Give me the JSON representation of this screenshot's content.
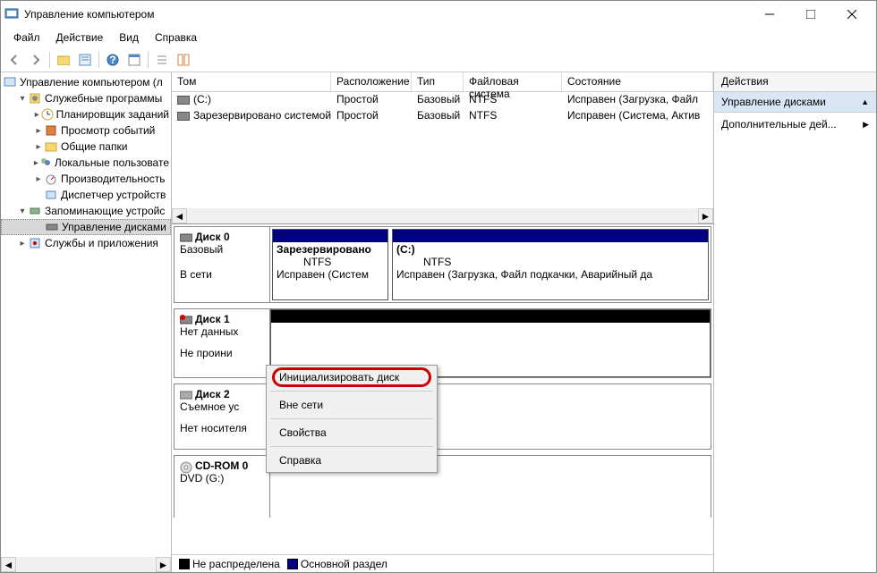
{
  "window": {
    "title": "Управление компьютером"
  },
  "menu": {
    "file": "Файл",
    "action": "Действие",
    "view": "Вид",
    "help": "Справка"
  },
  "tree": {
    "root": "Управление компьютером (л",
    "system_tools": "Служебные программы",
    "task_scheduler": "Планировщик заданий",
    "event_viewer": "Просмотр событий",
    "shared_folders": "Общие папки",
    "local_users": "Локальные пользовате",
    "performance": "Производительность",
    "device_manager": "Диспетчер устройств",
    "storage": "Запоминающие устройс",
    "disk_mgmt": "Управление дисками",
    "services": "Службы и приложения"
  },
  "grid": {
    "h_vol": "Том",
    "h_lay": "Расположение",
    "h_typ": "Тип",
    "h_fs": "Файловая система",
    "h_st": "Состояние",
    "rows": [
      {
        "vol": "(C:)",
        "lay": "Простой",
        "typ": "Базовый",
        "fs": "NTFS",
        "st": "Исправен (Загрузка, Файл"
      },
      {
        "vol": "Зарезервировано системой",
        "lay": "Простой",
        "typ": "Базовый",
        "fs": "NTFS",
        "st": "Исправен (Система, Актив"
      }
    ]
  },
  "disks": {
    "d0": {
      "label": "Диск 0",
      "type": "Базовый",
      "status": "В сети",
      "p1": {
        "name": "Зарезервировано",
        "fs": "NTFS",
        "st": "Исправен (Систем"
      },
      "p2": {
        "name": "(C:)",
        "fs": "NTFS",
        "st": "Исправен (Загрузка, Файл подкачки, Аварийный да"
      }
    },
    "d1": {
      "label": "Диск 1",
      "type": "Нет данных",
      "status": "Не проини"
    },
    "d2": {
      "label": "Диск 2",
      "type": "Съемное ус",
      "status": "Нет носителя"
    },
    "cd": {
      "label": "CD-ROM 0",
      "type": "DVD (G:)"
    }
  },
  "ctx": {
    "init": "Инициализировать диск",
    "offline": "Вне сети",
    "props": "Свойства",
    "help": "Справка"
  },
  "legend": {
    "unalloc": "Не распределена",
    "primary": "Основной раздел"
  },
  "actions": {
    "header": "Действия",
    "sel": "Управление дисками",
    "more": "Дополнительные дей..."
  }
}
